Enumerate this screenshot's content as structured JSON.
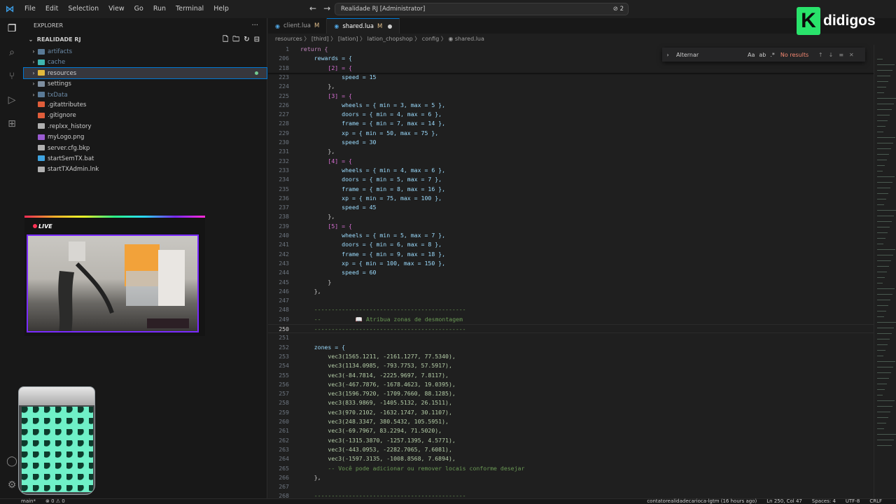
{
  "titlebar": {
    "menus": [
      "File",
      "Edit",
      "Selection",
      "View",
      "Go",
      "Run",
      "Terminal",
      "Help"
    ],
    "command_center": "Realidade RJ [Administrator]",
    "cc_badge": "⊘ 2",
    "back": "←",
    "forward": "→"
  },
  "brand": {
    "letter": "K",
    "name": "didigos",
    "color": "#29e36b"
  },
  "explorer": {
    "header": "EXPLORER",
    "workspace": "REALIDADE RJ",
    "tree": [
      {
        "label": "artifacts",
        "type": "folder",
        "dim": true,
        "color": "#5a7a96"
      },
      {
        "label": "cache",
        "type": "folder",
        "dim": true,
        "color": "#3fb6b0"
      },
      {
        "label": "resources",
        "type": "folder",
        "selected": true,
        "modified": true,
        "color": "#e2b93d"
      },
      {
        "label": "settings",
        "type": "folder",
        "color": "#7f8fa0"
      },
      {
        "label": "txData",
        "type": "folder",
        "dim": true,
        "color": "#5a7a96"
      },
      {
        "label": ".gitattributes",
        "type": "file",
        "color": "#e05d3a"
      },
      {
        "label": ".gitignore",
        "type": "file",
        "color": "#e05d3a"
      },
      {
        "label": ".replxx_history",
        "type": "file",
        "color": "#b0b0b0"
      },
      {
        "label": "myLogo.png",
        "type": "file",
        "color": "#9a5bd1"
      },
      {
        "label": "server.cfg.bkp",
        "type": "file",
        "color": "#b0b0b0"
      },
      {
        "label": "startSemTX.bat",
        "type": "file",
        "color": "#3fa3e0"
      },
      {
        "label": "startTXAdmin.lnk",
        "type": "file",
        "color": "#b0b0b0"
      }
    ]
  },
  "webcam": {
    "label": "LIVE"
  },
  "tabs": [
    {
      "name": "client.lua",
      "mod": "M",
      "active": false
    },
    {
      "name": "shared.lua",
      "mod": "M",
      "active": true,
      "dirty": true
    }
  ],
  "breadcrumb": "resources 〉 [third] 〉 [lation] 〉 lation_chopshop 〉 config 〉 ◉ shared.lua",
  "find": {
    "input": "Alternar",
    "opts": [
      "Aa",
      "ab",
      ".*"
    ],
    "results": "No results",
    "nav": [
      "↑",
      "↓",
      "≡",
      "✕"
    ]
  },
  "editor": {
    "lines": [
      {
        "n": "1",
        "code": "return {"
      },
      {
        "n": "206",
        "code": "    rewards = {"
      },
      {
        "n": "218",
        "code": "        [2] = {"
      },
      {
        "n": "223",
        "code": "            speed = 15"
      },
      {
        "n": "224",
        "code": "        },"
      },
      {
        "n": "225",
        "code": "        [3] = {"
      },
      {
        "n": "226",
        "code": "            wheels = { min = 3, max = 5 },"
      },
      {
        "n": "227",
        "code": "            doors = { min = 4, max = 6 },"
      },
      {
        "n": "228",
        "code": "            frame = { min = 7, max = 14 },"
      },
      {
        "n": "229",
        "code": "            xp = { min = 50, max = 75 },"
      },
      {
        "n": "230",
        "code": "            speed = 30"
      },
      {
        "n": "231",
        "code": "        },"
      },
      {
        "n": "232",
        "code": "        [4] = {"
      },
      {
        "n": "233",
        "code": "            wheels = { min = 4, max = 6 },"
      },
      {
        "n": "234",
        "code": "            doors = { min = 5, max = 7 },"
      },
      {
        "n": "235",
        "code": "            frame = { min = 8, max = 16 },"
      },
      {
        "n": "236",
        "code": "            xp = { min = 75, max = 100 },"
      },
      {
        "n": "237",
        "code": "            speed = 45"
      },
      {
        "n": "238",
        "code": "        },"
      },
      {
        "n": "239",
        "code": "        [5] = {"
      },
      {
        "n": "240",
        "code": "            wheels = { min = 5, max = 7 },"
      },
      {
        "n": "241",
        "code": "            doors = { min = 6, max = 8 },"
      },
      {
        "n": "242",
        "code": "            frame = { min = 9, max = 18 },"
      },
      {
        "n": "243",
        "code": "            xp = { min = 100, max = 150 },"
      },
      {
        "n": "244",
        "code": "            speed = 60"
      },
      {
        "n": "245",
        "code": "        }"
      },
      {
        "n": "246",
        "code": "    },"
      },
      {
        "n": "247",
        "code": ""
      },
      {
        "n": "248",
        "code": "    --------------------------------------------"
      },
      {
        "n": "249",
        "code": "    --          📖 Atribua zonas de desmontagem"
      },
      {
        "n": "250",
        "code": "    --------------------------------------------",
        "current": true
      },
      {
        "n": "251",
        "code": ""
      },
      {
        "n": "252",
        "code": "    zones = {"
      },
      {
        "n": "253",
        "code": "        vec3(1565.1211, -2161.1277, 77.5340),"
      },
      {
        "n": "254",
        "code": "        vec3(1134.0985, -793.7753, 57.5917),"
      },
      {
        "n": "255",
        "code": "        vec3(-84.7814, -2225.9697, 7.8117),"
      },
      {
        "n": "256",
        "code": "        vec3(-467.7876, -1678.4623, 19.0395),"
      },
      {
        "n": "257",
        "code": "        vec3(1596.7920, -1709.7660, 88.1285),"
      },
      {
        "n": "258",
        "code": "        vec3(833.9869, -1405.5132, 26.1511),"
      },
      {
        "n": "259",
        "code": "        vec3(970.2102, -1632.1747, 30.1107),"
      },
      {
        "n": "260",
        "code": "        vec3(248.3347, 380.5432, 105.5951),"
      },
      {
        "n": "261",
        "code": "        vec3(-69.7967, 83.2294, 71.5020),"
      },
      {
        "n": "262",
        "code": "        vec3(-1315.3870, -1257.1395, 4.5771),"
      },
      {
        "n": "263",
        "code": "        vec3(-443.0953, -2282.7065, 7.6081),"
      },
      {
        "n": "264",
        "code": "        vec3(-1597.3135, -1008.8568, 7.6894),"
      },
      {
        "n": "265",
        "code": "        -- Você pode adicionar ou remover locais conforme desejar"
      },
      {
        "n": "266",
        "code": "    },"
      },
      {
        "n": "267",
        "code": ""
      },
      {
        "n": "268",
        "code": "    --------------------------------------------"
      }
    ]
  },
  "statusbar": {
    "branch": "main*",
    "problems": "⊗ 0 ⚠ 0",
    "author": "contatorealidadecarioca-lgtm (16 hours ago)",
    "position": "Ln 250, Col 47",
    "spaces": "Spaces: 4",
    "encoding": "UTF-8",
    "eol": "CRLF"
  }
}
